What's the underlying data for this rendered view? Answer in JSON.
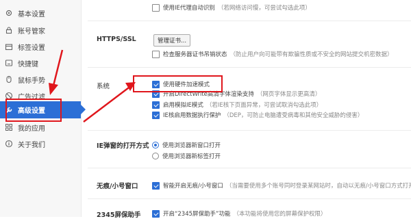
{
  "sidebar": {
    "items": [
      {
        "label": "基本设置",
        "icon": "settings-icon"
      },
      {
        "label": "账号管家",
        "icon": "lock-icon"
      },
      {
        "label": "标签设置",
        "icon": "tabs-icon"
      },
      {
        "label": "快捷键",
        "icon": "keyboard-icon"
      },
      {
        "label": "鼠标手势",
        "icon": "mouse-icon"
      },
      {
        "label": "广告过滤",
        "icon": "block-icon"
      },
      {
        "label": "高级设置",
        "icon": "wrench-icon",
        "active": true
      },
      {
        "label": "我的应用",
        "icon": "apps-icon"
      },
      {
        "label": "关于我们",
        "icon": "info-icon"
      }
    ]
  },
  "top_option": {
    "label": "使用IE代理自动识别",
    "hint": "（若网络访问慢，可尝试勾选此项）",
    "checked": false
  },
  "https": {
    "title": "HTTPS/SSL",
    "button": "管理证书...",
    "option": {
      "label": "检查服务器证书吊销状态",
      "hint": "（防止用户向可能带有欺骗性质或不安全的网站提交机密数据）",
      "checked": false
    }
  },
  "system": {
    "title": "系统",
    "options": [
      {
        "label": "使用硬件加速模式",
        "hint": "",
        "checked": true
      },
      {
        "label": "开启DirectWrite高清字体渲染支持",
        "hint": "（网页字体显示更高清）",
        "checked": true
      },
      {
        "label": "启用模拟IE模式",
        "hint": "（若IE核下页面异常，可尝试取消勾选此项）",
        "checked": true
      },
      {
        "label": "IE核启用数据执行保护",
        "hint": "（DEP，可防止电脑遭受病毒和其他安全威胁的侵害）",
        "checked": true
      }
    ]
  },
  "ie_popup": {
    "title": "IE弹窗的打开方式",
    "options": [
      {
        "label": "使用浏览器新窗口打开",
        "checked": true
      },
      {
        "label": "使用浏览器新标签打开",
        "checked": false
      }
    ]
  },
  "small_window": {
    "title": "无痕/小号窗口",
    "option": {
      "label": "智能开启无痕/小号窗口",
      "hint": "（当需要使用多个账号同时登录某网站时，自动以无痕/小号窗口方式打开该网站",
      "checked": true
    }
  },
  "screen_guard": {
    "title": "2345屏保助手",
    "option": {
      "label": "开启“2345屏保助手”功能",
      "hint": "（本功能将使用您的屏幕保护权限）",
      "checked": true
    }
  },
  "colors": {
    "accent": "#2c6fd6",
    "annotation": "#e0161c"
  }
}
